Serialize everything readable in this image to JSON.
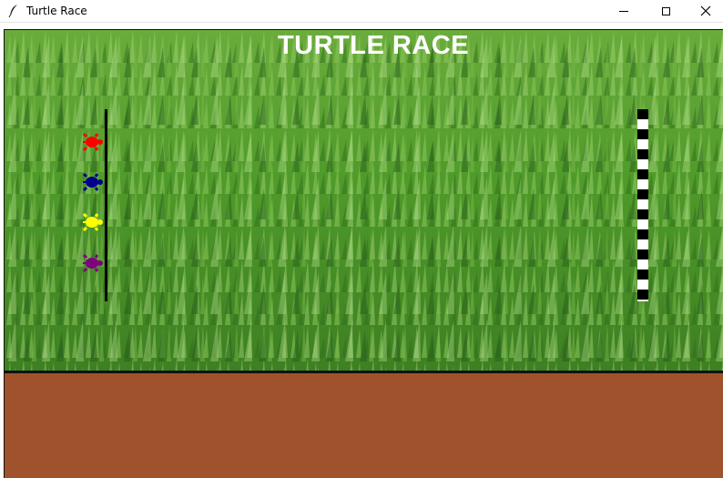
{
  "window": {
    "title": "Turtle Race",
    "app_icon": "feather-icon",
    "controls": [
      "minimize-icon",
      "maximize-icon",
      "close-icon"
    ]
  },
  "game": {
    "heading": "TURTLE RACE",
    "colors": {
      "grass": "#4f9a2a",
      "dirt": "#a0522d",
      "heading": "#ffffff",
      "finish_checker": [
        "#000000",
        "#ffffff"
      ]
    },
    "turtles": [
      {
        "color": "red"
      },
      {
        "color": "darkblue"
      },
      {
        "color": "yellow"
      },
      {
        "color": "purple"
      }
    ]
  }
}
